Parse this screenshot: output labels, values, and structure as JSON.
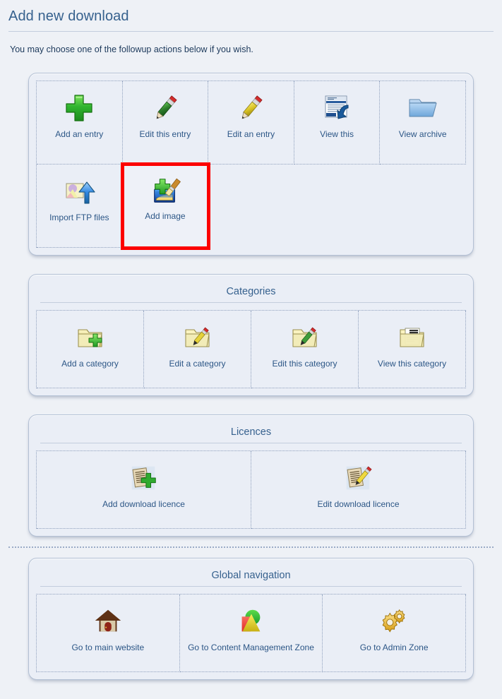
{
  "header": {
    "title": "Add new download",
    "intro": "You may choose one of the followup actions below if you wish."
  },
  "colors": {
    "page_bg": "#eef1f6",
    "panel_bg": "#eaeef6",
    "panel_border": "#b3c0d4",
    "title_text": "#36618e",
    "link_text": "#2c5686",
    "highlight": "#fc0000",
    "dotted_rule": "#8fa0bd"
  },
  "panels": [
    {
      "id": "actions",
      "title": "",
      "columns": 5,
      "items": [
        {
          "label": "Add an entry",
          "icon": "green-plus-icon",
          "highlighted": false
        },
        {
          "label": "Edit this entry",
          "icon": "green-pencil-icon",
          "highlighted": false
        },
        {
          "label": "Edit an entry",
          "icon": "yellow-pencil-icon",
          "highlighted": false
        },
        {
          "label": "View this",
          "icon": "document-back-arrow-icon",
          "highlighted": false
        },
        {
          "label": "View archive",
          "icon": "blue-folder-open-icon",
          "highlighted": false
        },
        {
          "label": "Import FTP files",
          "icon": "image-upload-arrow-icon",
          "highlighted": false
        },
        {
          "label": "Add image",
          "icon": "add-image-brush-icon",
          "highlighted": true
        }
      ]
    },
    {
      "id": "categories",
      "title": "Categories",
      "columns": 4,
      "items": [
        {
          "label": "Add a category",
          "icon": "folder-plus-icon",
          "highlighted": false
        },
        {
          "label": "Edit a category",
          "icon": "folder-pencil-yellow-icon",
          "highlighted": false
        },
        {
          "label": "Edit this category",
          "icon": "folder-pencil-green-icon",
          "highlighted": false
        },
        {
          "label": "View this category",
          "icon": "folder-document-icon",
          "highlighted": false
        }
      ]
    },
    {
      "id": "licences",
      "title": "Licences",
      "columns": 2,
      "items": [
        {
          "label": "Add download licence",
          "icon": "licence-plus-icon",
          "highlighted": false
        },
        {
          "label": "Edit download licence",
          "icon": "licence-pencil-icon",
          "highlighted": false
        }
      ]
    },
    {
      "id": "global-navigation",
      "title": "Global navigation",
      "columns": 3,
      "items": [
        {
          "label": "Go to main website",
          "icon": "house-icon",
          "highlighted": false
        },
        {
          "label": "Go to Content Management Zone",
          "icon": "shapes-cms-icon",
          "highlighted": false
        },
        {
          "label": "Go to Admin Zone",
          "icon": "gears-icon",
          "highlighted": false
        }
      ]
    }
  ]
}
